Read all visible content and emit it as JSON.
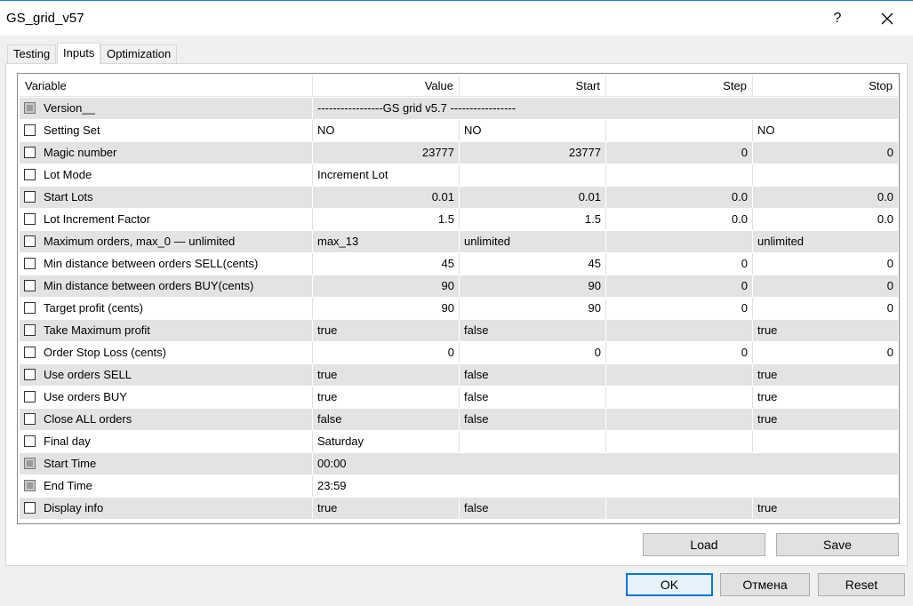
{
  "window": {
    "title": "GS_grid_v57",
    "help_label": "?",
    "close_icon": "close-icon"
  },
  "tabs": [
    {
      "label": "Testing",
      "active": false
    },
    {
      "label": "Inputs",
      "active": true
    },
    {
      "label": "Optimization",
      "active": false
    }
  ],
  "grid": {
    "columns": [
      "Variable",
      "Value",
      "Start",
      "Step",
      "Stop"
    ],
    "rows": [
      {
        "name": "Version__",
        "value": "-----------------GS grid v5.7 -----------------",
        "start": "",
        "step": "",
        "stop": "",
        "span": true,
        "disabled": true
      },
      {
        "name": "Setting Set",
        "value": "NO",
        "start": "NO",
        "step": "",
        "stop": "NO"
      },
      {
        "name": "Magic number",
        "value": "23777",
        "start": "23777",
        "step": "0",
        "stop": "0",
        "numeric": true
      },
      {
        "name": "Lot Mode",
        "value": "Increment Lot",
        "start": "",
        "step": "",
        "stop": ""
      },
      {
        "name": "Start Lots",
        "value": "0.01",
        "start": "0.01",
        "step": "0.0",
        "stop": "0.0",
        "numeric": true
      },
      {
        "name": "Lot Increment Factor",
        "value": "1.5",
        "start": "1.5",
        "step": "0.0",
        "stop": "0.0",
        "numeric": true
      },
      {
        "name": "Maximum orders, max_0 — unlimited",
        "value": "max_13",
        "start": "unlimited",
        "step": "",
        "stop": "unlimited"
      },
      {
        "name": "Min distance between orders SELL(cents)",
        "value": "45",
        "start": "45",
        "step": "0",
        "stop": "0",
        "numeric": true
      },
      {
        "name": "Min distance between orders BUY(cents)",
        "value": "90",
        "start": "90",
        "step": "0",
        "stop": "0",
        "numeric": true
      },
      {
        "name": "Target profit (cents)",
        "value": "90",
        "start": "90",
        "step": "0",
        "stop": "0",
        "numeric": true
      },
      {
        "name": "Take Maximum profit",
        "value": "true",
        "start": "false",
        "step": "",
        "stop": "true"
      },
      {
        "name": "Order Stop Loss (cents)",
        "value": "0",
        "start": "0",
        "step": "0",
        "stop": "0",
        "numeric": true
      },
      {
        "name": "Use orders SELL",
        "value": "true",
        "start": "false",
        "step": "",
        "stop": "true"
      },
      {
        "name": "Use orders BUY",
        "value": "true",
        "start": "false",
        "step": "",
        "stop": "true"
      },
      {
        "name": "Close ALL orders",
        "value": "false",
        "start": "false",
        "step": "",
        "stop": "true"
      },
      {
        "name": "Final day",
        "value": "Saturday",
        "start": "",
        "step": "",
        "stop": ""
      },
      {
        "name": "Start Time",
        "value": "00:00",
        "start": "",
        "step": "",
        "stop": "",
        "span": true,
        "disabled": true
      },
      {
        "name": "End Time",
        "value": "23:59",
        "start": "",
        "step": "",
        "stop": "",
        "span": true,
        "disabled": true
      },
      {
        "name": "Display info",
        "value": "true",
        "start": "false",
        "step": "",
        "stop": "true"
      }
    ]
  },
  "buttons": {
    "load": "Load",
    "save": "Save",
    "ok": "OK",
    "cancel": "Отмена",
    "reset": "Reset"
  },
  "colors": {
    "accent": "#0078d7",
    "row_alt": "#e3e3e3",
    "title_border": "#2b7fd6"
  }
}
